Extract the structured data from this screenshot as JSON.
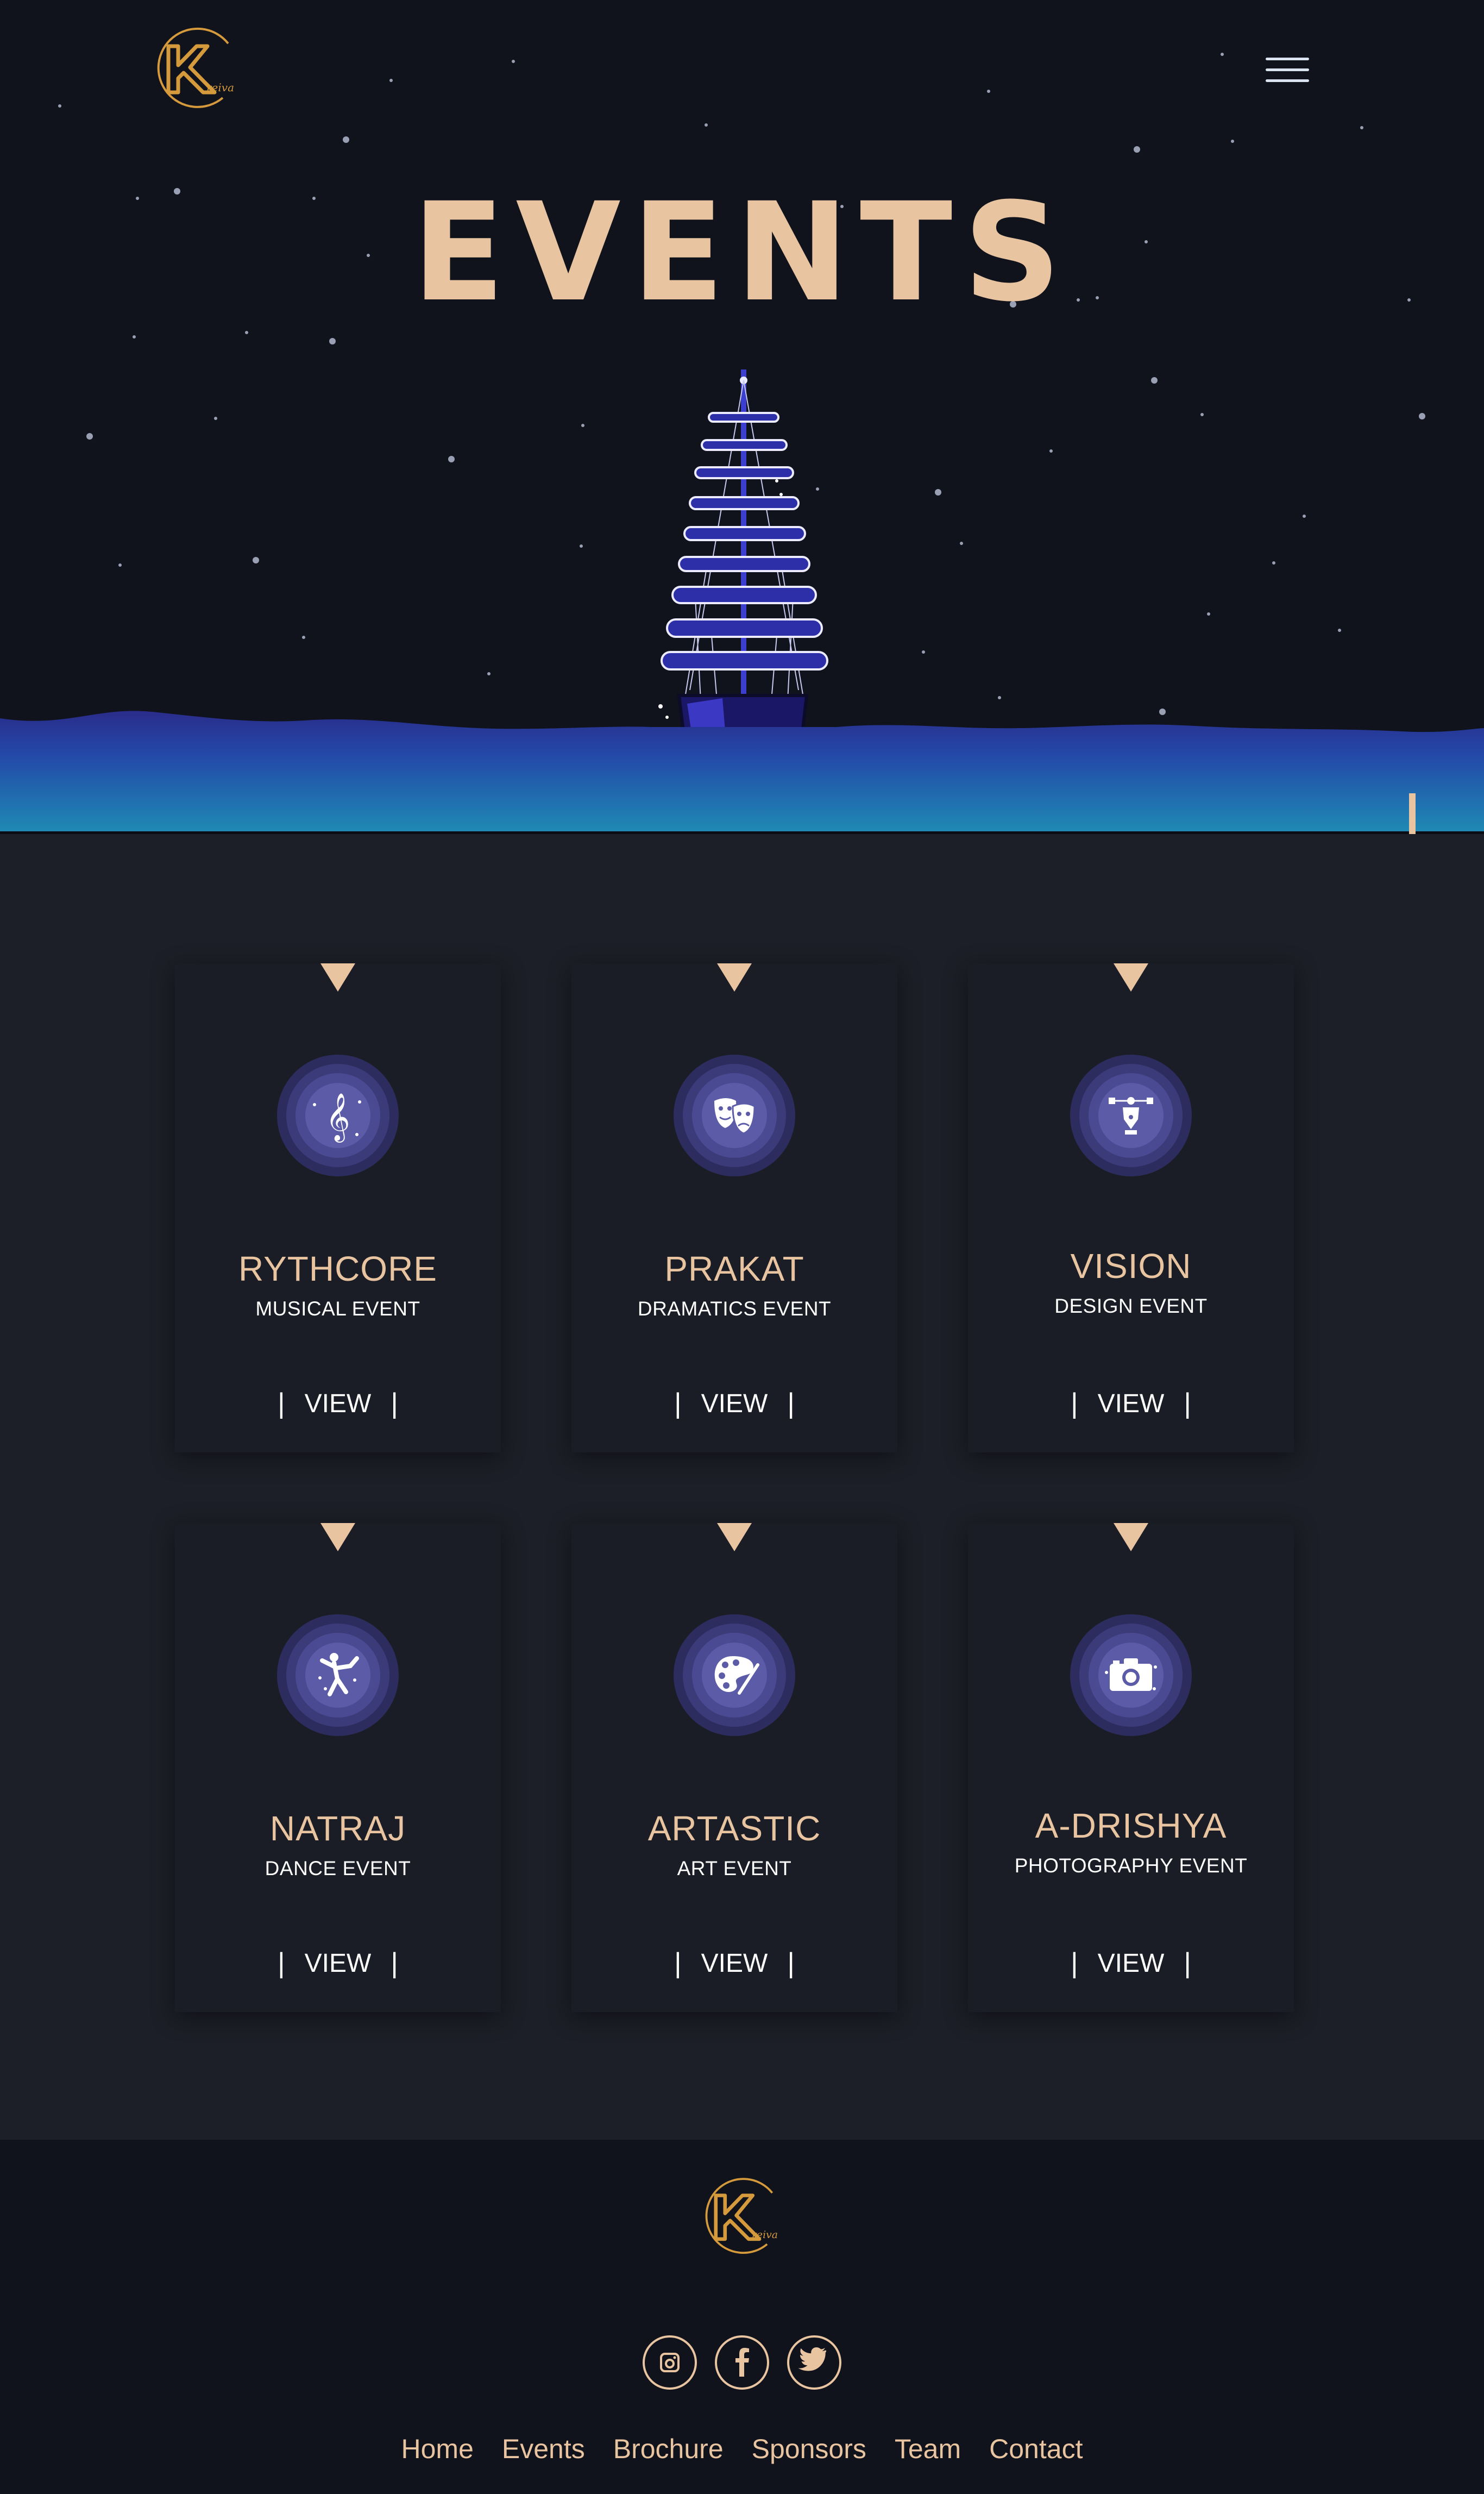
{
  "colors": {
    "accent": "#e8c4a0",
    "background": "#1d1f28",
    "hero_background": "#10121c",
    "sea_top": "#2a2c8a",
    "sea_bottom": "#1f8bb4",
    "icon_circle": "#5b5ba8"
  },
  "header": {
    "logo_icon": "kreiva-logo",
    "menu_icon": "hamburger-menu-icon"
  },
  "hero": {
    "title": "EVENTS",
    "illustration": "ship-at-sea",
    "scroll_icon": "arrow-down-icon"
  },
  "events": [
    {
      "title": "RYTHCORE",
      "subtitle": "MUSICAL EVENT",
      "icon": "treble-clef-icon",
      "view_label": "VIEW"
    },
    {
      "title": "PRAKAT",
      "subtitle": "DRAMATICS EVENT",
      "icon": "theatre-masks-icon",
      "view_label": "VIEW"
    },
    {
      "title": "VISION",
      "subtitle": "DESIGN EVENT",
      "icon": "pen-tool-icon",
      "view_label": "VIEW"
    },
    {
      "title": "NATRAJ",
      "subtitle": "DANCE EVENT",
      "icon": "dancer-icon",
      "view_label": "VIEW"
    },
    {
      "title": "ARTASTIC",
      "subtitle": "ART EVENT",
      "icon": "palette-icon",
      "view_label": "VIEW"
    },
    {
      "title": "A-DRISHYA",
      "subtitle": "PHOTOGRAPHY EVENT",
      "icon": "camera-icon",
      "view_label": "VIEW"
    }
  ],
  "footer": {
    "logo_icon": "kreiva-logo",
    "social_icons": [
      "instagram-icon",
      "facebook-icon",
      "twitter-icon"
    ],
    "nav": [
      "Home",
      "Events",
      "Brochure",
      "Sponsors",
      "Team",
      "Contact"
    ]
  }
}
